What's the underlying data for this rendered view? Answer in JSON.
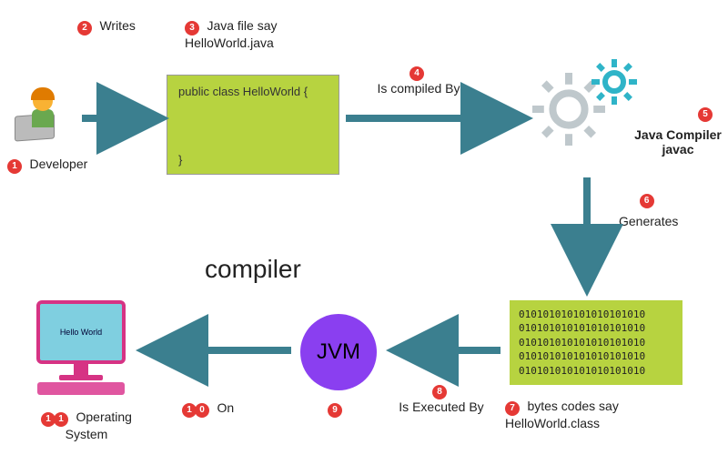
{
  "steps": {
    "s1": {
      "num": "1",
      "label": "Developer"
    },
    "s2": {
      "num": "2",
      "label": "Writes"
    },
    "s3": {
      "num": "3",
      "label": "Java file say HelloWorld.java"
    },
    "s4": {
      "num": "4",
      "label": "Is compiled By"
    },
    "s5": {
      "num": "5",
      "label": "Java Compiler javac"
    },
    "s6": {
      "num": "6",
      "label": "Generates"
    },
    "s7": {
      "num": "7",
      "label": "bytes codes say HelloWorld.class"
    },
    "s8": {
      "num": "8",
      "label": "Is Executed By"
    },
    "s9": {
      "num": "9",
      "label": ""
    },
    "s10": {
      "num1": "1",
      "num2": "0",
      "label": "On"
    },
    "s11": {
      "num1": "1",
      "num2": "1",
      "label": "Operating System"
    }
  },
  "code": {
    "line1": "public class HelloWorld {",
    "line2": "}"
  },
  "bytecode": "010101010101010101010\n010101010101010101010\n010101010101010101010\n010101010101010101010\n010101010101010101010",
  "jvm_label": "JVM",
  "title": "compiler",
  "screen_text": "Hello World",
  "colors": {
    "accent": "#3b7f8f",
    "box": "#b7d340",
    "badge": "#e53935",
    "jvm": "#8a3ff0",
    "computer": "#d63384"
  }
}
